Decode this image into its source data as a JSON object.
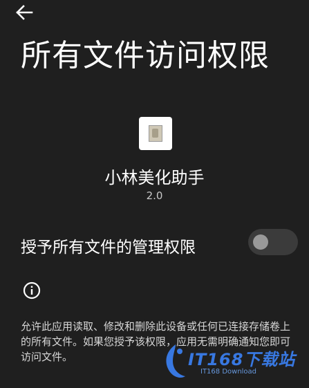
{
  "header": {
    "back_icon": "arrow-left-icon",
    "title": "所有文件访问权限"
  },
  "app": {
    "icon": "app-image-icon",
    "name": "小林美化助手",
    "version": "2.0"
  },
  "permission": {
    "label": "授予所有文件的管理权限",
    "enabled": false
  },
  "info": {
    "icon": "info-icon",
    "description": "允许此应用读取、修改和删除此设备或任何已连接存储卷上的所有文件。如果您授予该权限，应用无需明确通知您即可访问文件。"
  },
  "watermark": {
    "main": "IT168下载站",
    "sub": "IT168 Download"
  },
  "colors": {
    "background": "#1f1f1f",
    "text": "#ffffff",
    "secondary_text": "#c9c9c9",
    "toggle_track": "#3b3b3b",
    "toggle_knob": "#999999",
    "watermark": "#3b82f6"
  }
}
